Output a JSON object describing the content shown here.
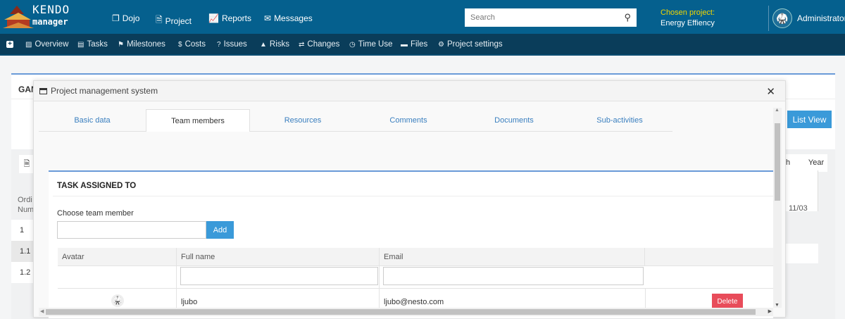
{
  "brand": {
    "line1": "KENDO",
    "line2": "manager"
  },
  "topnav": [
    {
      "label": "Dojo",
      "icon": "window-icon"
    },
    {
      "label": "Project",
      "icon": "document-icon"
    },
    {
      "label": "Reports",
      "icon": "chart-icon"
    },
    {
      "label": "Messages",
      "icon": "envelope-icon"
    }
  ],
  "search": {
    "placeholder": "Search"
  },
  "project": {
    "label": "Chosen project:",
    "name": "Energy Effiency"
  },
  "user": {
    "name": "Administrator"
  },
  "subnav": [
    {
      "label": "Overview",
      "icon": "▨"
    },
    {
      "label": "Tasks",
      "icon": "▤"
    },
    {
      "label": "Milestones",
      "icon": "⚑"
    },
    {
      "label": "Costs",
      "icon": "$"
    },
    {
      "label": "Issues",
      "icon": "?"
    },
    {
      "label": "Risks",
      "icon": "▲"
    },
    {
      "label": "Changes",
      "icon": "⇄"
    },
    {
      "label": "Time Use",
      "icon": "◷"
    },
    {
      "label": "Files",
      "icon": "▬"
    },
    {
      "label": "Project settings",
      "icon": "⚙"
    }
  ],
  "background": {
    "title": "GAN",
    "list_view": "List View",
    "views": [
      "th",
      "Year"
    ],
    "col_header": [
      "Ordi",
      "Num"
    ],
    "rows": [
      "1",
      "1.1",
      "1.2"
    ],
    "date": "11/03"
  },
  "modal": {
    "title": "Project management system",
    "tabs": [
      "Basic data",
      "Team members",
      "Resources",
      "Comments",
      "Documents",
      "Sub-activities"
    ],
    "section_title": "TASK ASSIGNED TO",
    "choose_label": "Choose team member",
    "add_label": "Add",
    "columns": [
      "Avatar",
      "Full name",
      "Email"
    ],
    "rows": [
      {
        "name": "ljubo",
        "email": "ljubo@nesto.com",
        "action": "Delete"
      }
    ]
  },
  "colors": {
    "topbar": "#05608e",
    "subnav": "#0a3d5a",
    "accent": "#3a9ad9",
    "danger": "#e84c5a",
    "project_label": "#f2d600"
  }
}
